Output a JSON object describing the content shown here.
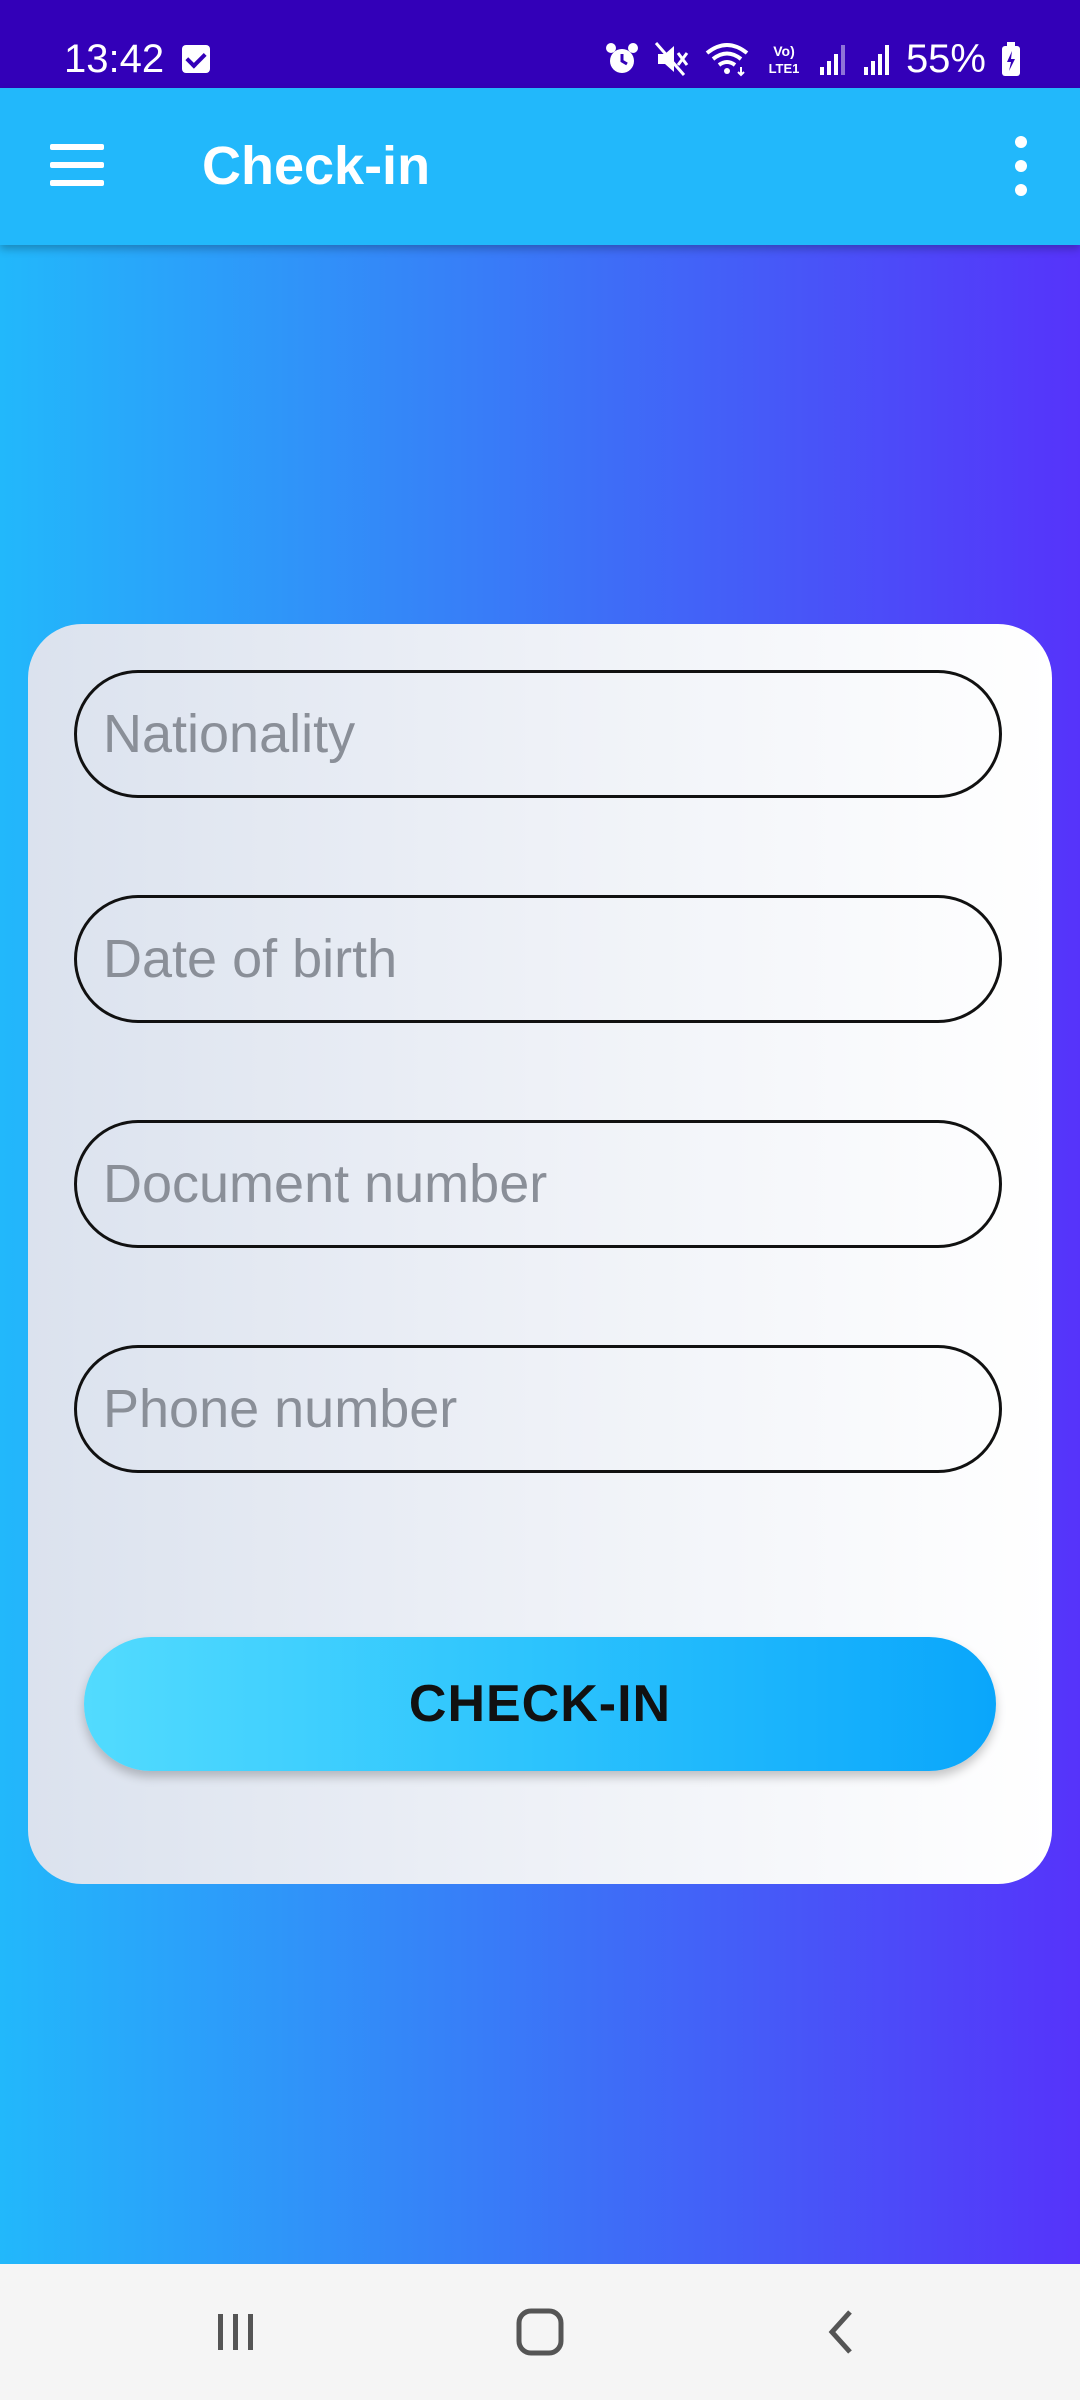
{
  "status_bar": {
    "time": "13:42",
    "battery": "55%",
    "icons": [
      "checkbox-notification-icon",
      "alarm-icon",
      "mute-icon",
      "wifi-icon",
      "volte-icon",
      "signal-icon",
      "signal-icon",
      "battery-charging-icon"
    ]
  },
  "app_bar": {
    "title": "Check-in",
    "menu_icon": "hamburger-menu-icon",
    "overflow_icon": "more-vertical-icon"
  },
  "form": {
    "fields": [
      {
        "name": "nationality",
        "placeholder": "Nationality",
        "value": ""
      },
      {
        "name": "date-of-birth",
        "placeholder": "Date of birth",
        "value": ""
      },
      {
        "name": "document-number",
        "placeholder": "Document number",
        "value": ""
      },
      {
        "name": "phone-number",
        "placeholder": "Phone number",
        "value": ""
      }
    ],
    "submit_label": "CHECK-IN"
  },
  "nav_bar": {
    "items": [
      "recent-apps-icon",
      "home-icon",
      "back-icon"
    ]
  },
  "colors": {
    "status_bar": "#3300b8",
    "app_bar": "#22b8fb",
    "gradient_start": "#22b8fb",
    "gradient_end": "#5633fa",
    "button_start": "#52dbfe",
    "button_end": "#0aa6fb"
  }
}
